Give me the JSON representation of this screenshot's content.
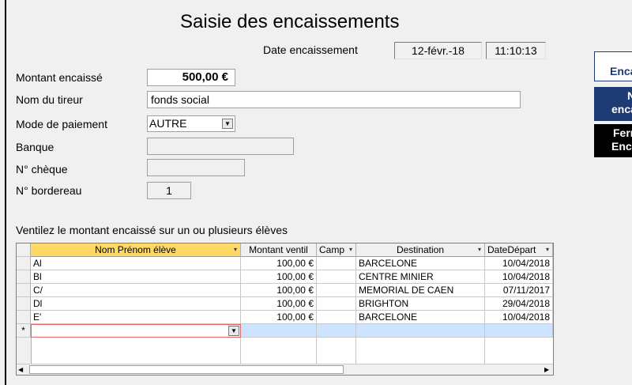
{
  "form": {
    "title": "Saisie des encaissements",
    "date_label": "Date encaissement",
    "date_value": "12-févr.-18",
    "time_value": "11:10:13",
    "montant_label": "Montant encaissé",
    "montant_value": "500,00 €",
    "tireur_label": "Nom du tireur",
    "tireur_value": "fonds social",
    "mode_label": "Mode de paiement",
    "mode_value": "AUTRE",
    "banque_label": "Banque",
    "banque_value": "",
    "cheque_label": "N° chèque",
    "cheque_value": "",
    "bordereau_label": "N° bordereau",
    "bordereau_value": "1",
    "ventil_label": "Ventilez le montant encaissé sur un ou plusieurs élèves"
  },
  "right_buttons": {
    "btn1": "Encai",
    "btn2_line1": "N",
    "btn2_line2": "enca",
    "btn3_line1": "Ferm",
    "btn3_line2": "Encai"
  },
  "grid": {
    "columns": [
      "Nom Prénom élève",
      "Montant ventil",
      "Camp",
      "Destination",
      "DateDépart"
    ],
    "rows": [
      {
        "nom": "Al",
        "montant": "100,00 €",
        "camp": "",
        "destination": "BARCELONE",
        "date": "10/04/2018"
      },
      {
        "nom": "Bl",
        "montant": "100,00 €",
        "camp": "",
        "destination": "CENTRE MINIER",
        "date": "10/04/2018"
      },
      {
        "nom": "C/",
        "montant": "100,00 €",
        "camp": "",
        "destination": "MEMORIAL DE CAEN",
        "date": "07/11/2017"
      },
      {
        "nom": "Dl",
        "montant": "100,00 €",
        "camp": "",
        "destination": "BRIGHTON",
        "date": "29/04/2018"
      },
      {
        "nom": "E'",
        "montant": "100,00 €",
        "camp": "",
        "destination": "BARCELONE",
        "date": "10/04/2018"
      }
    ],
    "new_row_marker": "*"
  },
  "icons": {
    "dropdown": "chevron-down-icon",
    "new_record": "asterisk-icon",
    "scroll_left": "triangle-left-icon",
    "scroll_right": "triangle-right-icon"
  },
  "colors": {
    "header_selected": "#ffd966",
    "new_row_highlight": "#cce4ff",
    "button_blue": "#1f3b73",
    "button_black": "#000000"
  }
}
